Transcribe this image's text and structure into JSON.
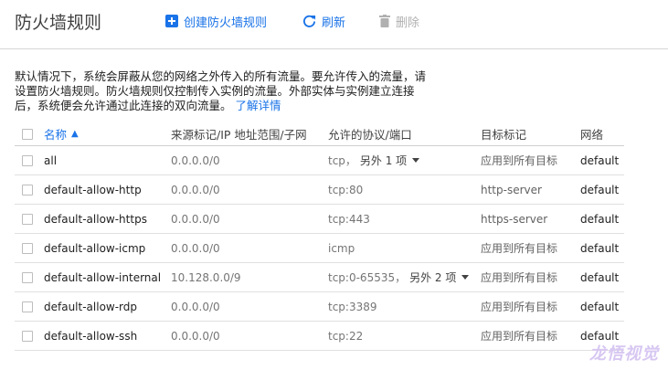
{
  "header": {
    "title": "防火墙规则",
    "create_label": "创建防火墙规则",
    "refresh_label": "刷新",
    "delete_label": "删除"
  },
  "description": {
    "line1": "默认情况下，系统会屏蔽从您的网络之外传入的所有流量。要允许传入的流量，请",
    "line2": "设置防火墙规则。防火墙规则仅控制传入实例的流量。外部实体与实例建立连接",
    "line3": "后，系统便会允许通过此连接的双向流量。",
    "learn_more": "了解详情"
  },
  "table": {
    "columns": {
      "name": "名称",
      "source": "来源标记/IP 地址范围/子网",
      "protocols": "允许的协议/端口",
      "target": "目标标记",
      "network": "网络"
    },
    "rows": [
      {
        "name": "all",
        "source": "0.0.0.0/0",
        "proto": "tcp，",
        "proto_more": "另外 1 项",
        "target": "应用到所有目标",
        "network": "default"
      },
      {
        "name": "default-allow-http",
        "source": "0.0.0.0/0",
        "proto": "tcp:80",
        "proto_more": "",
        "target": "http-server",
        "network": "default"
      },
      {
        "name": "default-allow-https",
        "source": "0.0.0.0/0",
        "proto": "tcp:443",
        "proto_more": "",
        "target": "https-server",
        "network": "default"
      },
      {
        "name": "default-allow-icmp",
        "source": "0.0.0.0/0",
        "proto": "icmp",
        "proto_more": "",
        "target": "应用到所有目标",
        "network": "default"
      },
      {
        "name": "default-allow-internal",
        "source": "10.128.0.0/9",
        "proto": "tcp:0-65535，",
        "proto_more": "另外 2 项",
        "target": "应用到所有目标",
        "network": "default"
      },
      {
        "name": "default-allow-rdp",
        "source": "0.0.0.0/0",
        "proto": "tcp:3389",
        "proto_more": "",
        "target": "应用到所有目标",
        "network": "default"
      },
      {
        "name": "default-allow-ssh",
        "source": "0.0.0.0/0",
        "proto": "tcp:22",
        "proto_more": "",
        "target": "应用到所有目标",
        "network": "default"
      }
    ]
  },
  "watermark": "龙悟视觉",
  "colors": {
    "accent": "#1a73e8",
    "disabled": "#b0b0b0"
  }
}
